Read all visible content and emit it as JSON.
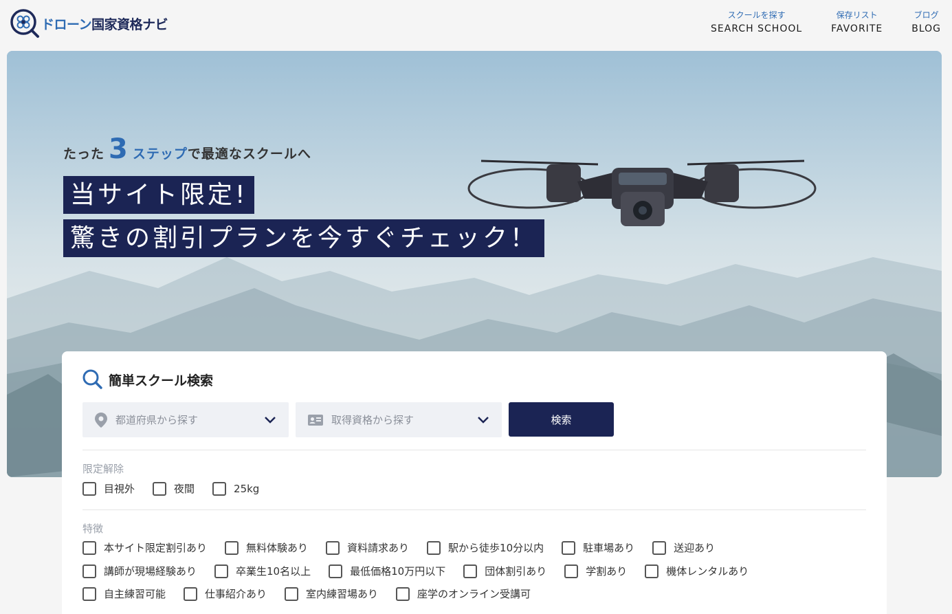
{
  "header": {
    "logo_text_a": "ドローン",
    "logo_text_b": "国家資格ナビ",
    "nav": [
      {
        "jp": "スクールを探す",
        "en": "SEARCH SCHOOL"
      },
      {
        "jp": "保存リスト",
        "en": "FAVORITE"
      },
      {
        "jp": "ブログ",
        "en": "BLOG"
      }
    ]
  },
  "hero": {
    "tagline_pre": "たった",
    "tagline_num": "3",
    "tagline_blue": "ステップ",
    "tagline_post": "で最適なスクールへ",
    "headline_1": "当サイト限定!",
    "headline_2": "驚きの割引プランを今すぐチェック！"
  },
  "search": {
    "title": "簡単スクール検索",
    "prefecture_placeholder": "都道府県から探す",
    "license_placeholder": "取得資格から探す",
    "button": "検索",
    "section_limit": "限定解除",
    "limit_options": [
      "目視外",
      "夜間",
      "25kg"
    ],
    "section_features": "特徴",
    "features_row1": [
      "本サイト限定割引あり",
      "無料体験あり",
      "資料請求あり",
      "駅から徒歩10分以内",
      "駐車場あり",
      "送迎あり"
    ],
    "features_row2": [
      "講師が現場経験あり",
      "卒業生10名以上",
      "最低価格10万円以下",
      "団体割引あり",
      "学割あり",
      "機体レンタルあり"
    ],
    "features_row3": [
      "自主練習可能",
      "仕事紹介あり",
      "室内練習場あり",
      "座学のオンライン受講可"
    ]
  },
  "colors": {
    "navy": "#1b2454",
    "accent_blue": "#2e6bb3"
  }
}
